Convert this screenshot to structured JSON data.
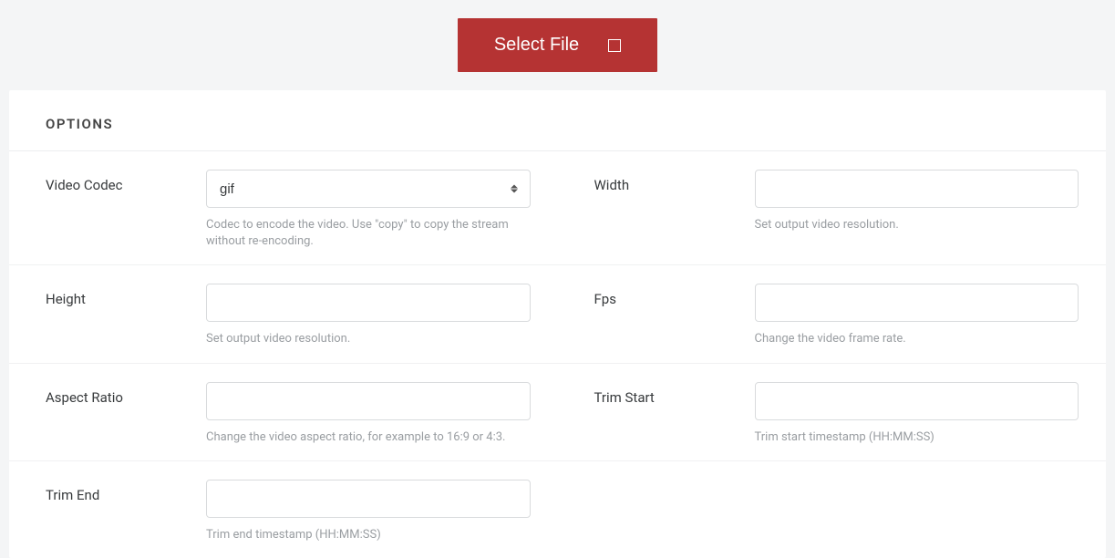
{
  "selectFile": {
    "label": "Select File"
  },
  "panel": {
    "title": "OPTIONS"
  },
  "fields": {
    "videoCodec": {
      "label": "Video Codec",
      "value": "gif",
      "help": "Codec to encode the video. Use \"copy\" to copy the stream without re-encoding."
    },
    "width": {
      "label": "Width",
      "value": "",
      "help": "Set output video resolution."
    },
    "height": {
      "label": "Height",
      "value": "",
      "help": "Set output video resolution."
    },
    "fps": {
      "label": "Fps",
      "value": "",
      "help": "Change the video frame rate."
    },
    "aspectRatio": {
      "label": "Aspect Ratio",
      "value": "",
      "help": "Change the video aspect ratio, for example to 16:9 or 4:3."
    },
    "trimStart": {
      "label": "Trim Start",
      "value": "",
      "help": "Trim start timestamp (HH:MM:SS)"
    },
    "trimEnd": {
      "label": "Trim End",
      "value": "",
      "help": "Trim end timestamp (HH:MM:SS)"
    }
  }
}
